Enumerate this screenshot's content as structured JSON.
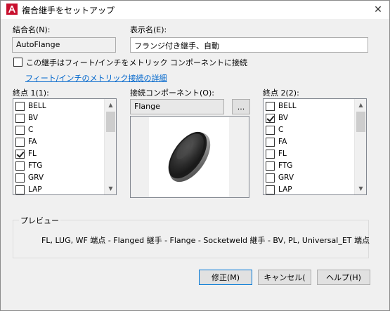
{
  "window": {
    "title": "複合継手をセットアップ"
  },
  "fields": {
    "join_name_label": "結合名(N):",
    "join_name_value": "AutoFlange",
    "display_name_label": "表示名(E):",
    "display_name_value": "フランジ付き継手、自動"
  },
  "metric_option": {
    "checkbox_label": "この継手はフィート/インチをメトリック コンポーネントに接続",
    "checked": false,
    "details_link": "フィート/インチのメトリック接続の詳細"
  },
  "end1": {
    "label": "終点 1(1):",
    "items": [
      {
        "label": "BELL",
        "checked": false
      },
      {
        "label": "BV",
        "checked": false
      },
      {
        "label": "C",
        "checked": false
      },
      {
        "label": "FA",
        "checked": false
      },
      {
        "label": "FL",
        "checked": true
      },
      {
        "label": "FTG",
        "checked": false
      },
      {
        "label": "GRV",
        "checked": false
      },
      {
        "label": "LAP",
        "checked": false
      }
    ]
  },
  "component": {
    "label": "接続コンポーネント(O):",
    "value": "Flange",
    "browse_label": "..."
  },
  "end2": {
    "label": "終点 2(2):",
    "items": [
      {
        "label": "BELL",
        "checked": false
      },
      {
        "label": "BV",
        "checked": true
      },
      {
        "label": "C",
        "checked": false
      },
      {
        "label": "FA",
        "checked": false
      },
      {
        "label": "FL",
        "checked": false
      },
      {
        "label": "FTG",
        "checked": false
      },
      {
        "label": "GRV",
        "checked": false
      },
      {
        "label": "LAP",
        "checked": false
      }
    ]
  },
  "preview": {
    "title": "プレビュー",
    "text": "FL, LUG, WF 端点 - Flanged 継手 - Flange - Socketweld 継手 - BV, PL, Universal_ET 端点"
  },
  "buttons": {
    "ok": "修正(M)",
    "cancel": "キャンセル(",
    "help": "ヘルプ(H)"
  },
  "colors": {
    "accent": "#0078d7",
    "link": "#0066cc",
    "app_icon": "#c8102e"
  }
}
